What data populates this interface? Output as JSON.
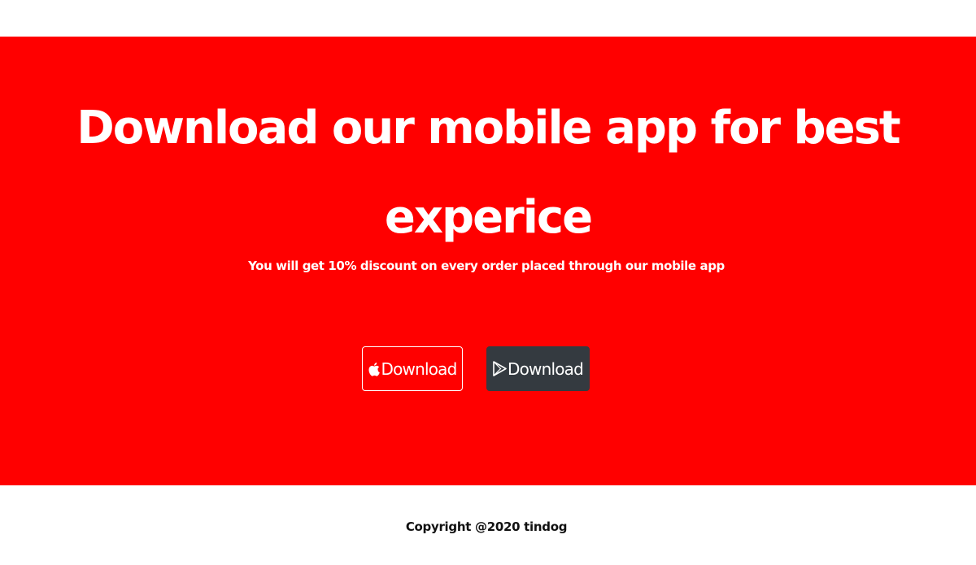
{
  "hero": {
    "title_line1": "Download our mobile app for best",
    "title_line2": "experice",
    "subtitle": "You will get 10% discount on every order placed through our mobile app",
    "background_color": "#ff0000"
  },
  "buttons": {
    "apple": {
      "label": "Download",
      "icon": "apple-icon"
    },
    "play": {
      "label": "Download",
      "icon": "google-play-icon",
      "color": "#343a40"
    }
  },
  "footer": {
    "copyright": "Copyright @2020 tindog"
  }
}
